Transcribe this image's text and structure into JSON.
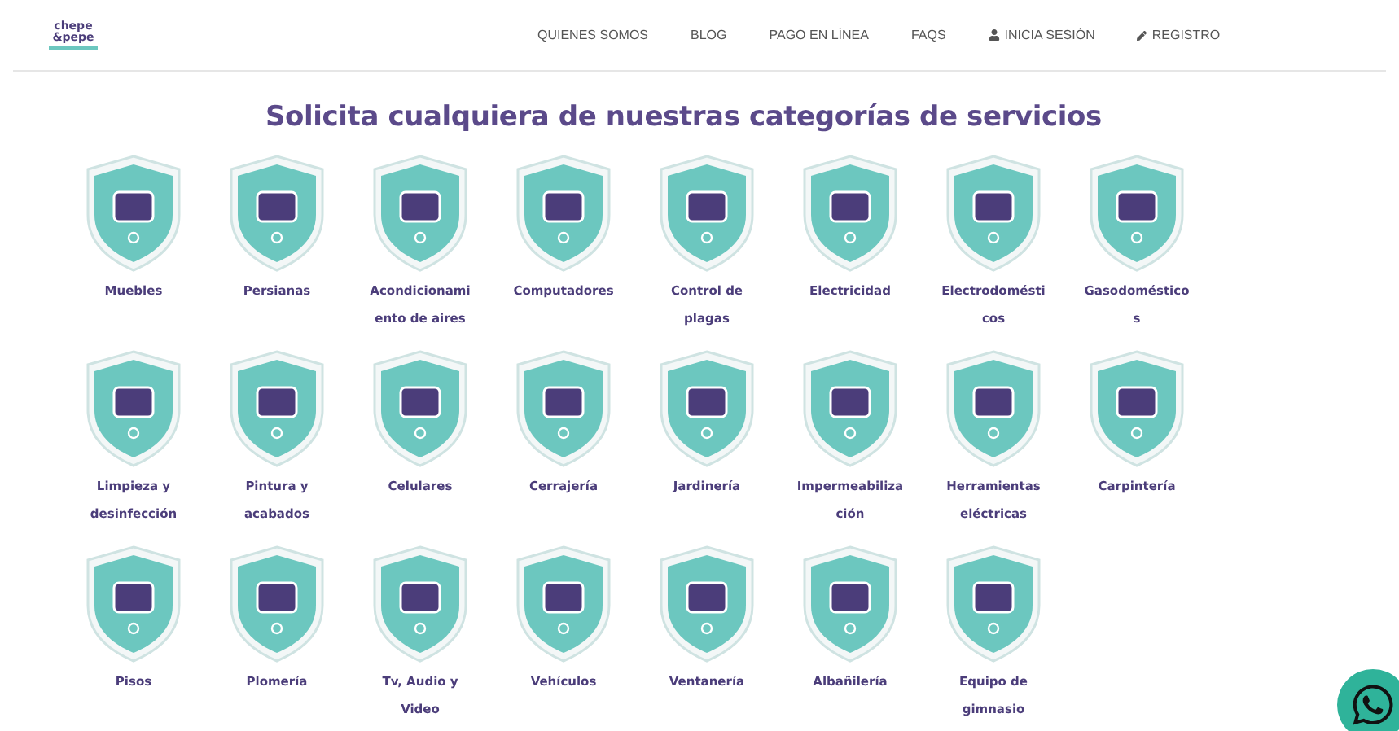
{
  "logo": {
    "lines": [
      "chepe",
      "&pepe"
    ]
  },
  "nav": [
    {
      "label": "QUIENES SOMOS",
      "kind": "plain"
    },
    {
      "label": "BLOG",
      "kind": "plain"
    },
    {
      "label": "PAGO EN LÍNEA",
      "kind": "plain"
    },
    {
      "label": "FAQS",
      "kind": "plain"
    },
    {
      "label": "INICIA SESIÓN",
      "kind": "login"
    },
    {
      "label": "REGISTRO",
      "kind": "signup"
    }
  ],
  "title": "Solicita cualquiera de nuestras categorías de servicios",
  "categories": [
    [
      {
        "lines": [
          "Muebles"
        ]
      },
      {
        "lines": [
          "Persianas"
        ]
      },
      {
        "lines": [
          "Acondicionami",
          "ento de aires"
        ]
      },
      {
        "lines": [
          "Computadores"
        ]
      },
      {
        "lines": [
          "Control de",
          "plagas"
        ]
      },
      {
        "lines": [
          "Electricidad"
        ]
      },
      {
        "lines": [
          "Electrodomésti",
          "cos"
        ]
      },
      {
        "lines": [
          "Gasodoméstico",
          "s"
        ]
      }
    ],
    [
      {
        "lines": [
          "Limpieza y",
          "desinfección"
        ]
      },
      {
        "lines": [
          "Pintura y",
          "acabados"
        ]
      },
      {
        "lines": [
          "Celulares"
        ]
      },
      {
        "lines": [
          "Cerrajería"
        ]
      },
      {
        "lines": [
          "Jardinería"
        ]
      },
      {
        "lines": [
          "Impermeabiliza",
          "ción"
        ]
      },
      {
        "lines": [
          "Herramientas",
          "eléctricas"
        ]
      },
      {
        "lines": [
          "Carpintería"
        ]
      }
    ],
    [
      {
        "lines": [
          "Pisos"
        ]
      },
      {
        "lines": [
          "Plomería"
        ]
      },
      {
        "lines": [
          "Tv, Audio y",
          "Video"
        ]
      },
      {
        "lines": [
          "Vehículos"
        ]
      },
      {
        "lines": [
          "Ventanería"
        ]
      },
      {
        "lines": [
          "Albañilería"
        ]
      },
      {
        "lines": [
          "Equipo de",
          "gimnasio"
        ]
      }
    ]
  ]
}
